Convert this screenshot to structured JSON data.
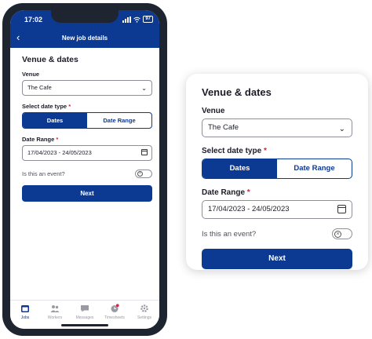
{
  "status": {
    "time": "17:02",
    "battery": "97"
  },
  "topbar": {
    "title": "New job details"
  },
  "form": {
    "title": "Venue & dates",
    "venue_label": "Venue",
    "venue_value": "The Cafe",
    "date_type_label": "Select date type",
    "required_mark": "*",
    "date_type_options": [
      "Dates",
      "Date Range"
    ],
    "date_type_selected": "Dates",
    "date_range_label": "Date Range",
    "date_range_value": "17/04/2023 - 24/05/2023",
    "event_question": "Is this an event?",
    "event_toggle_on": false,
    "next_label": "Next"
  },
  "tabbar": {
    "items": [
      {
        "label": "Jobs",
        "icon": "calendar-icon",
        "active": true
      },
      {
        "label": "Workers",
        "icon": "people-icon",
        "active": false
      },
      {
        "label": "Messages",
        "icon": "chat-icon",
        "active": false
      },
      {
        "label": "Timesheets",
        "icon": "clock-icon",
        "active": false
      },
      {
        "label": "Settings",
        "icon": "gear-icon",
        "active": false
      }
    ]
  },
  "colors": {
    "primary": "#0c3a93",
    "required": "#d0263b",
    "frame": "#1f2431"
  }
}
